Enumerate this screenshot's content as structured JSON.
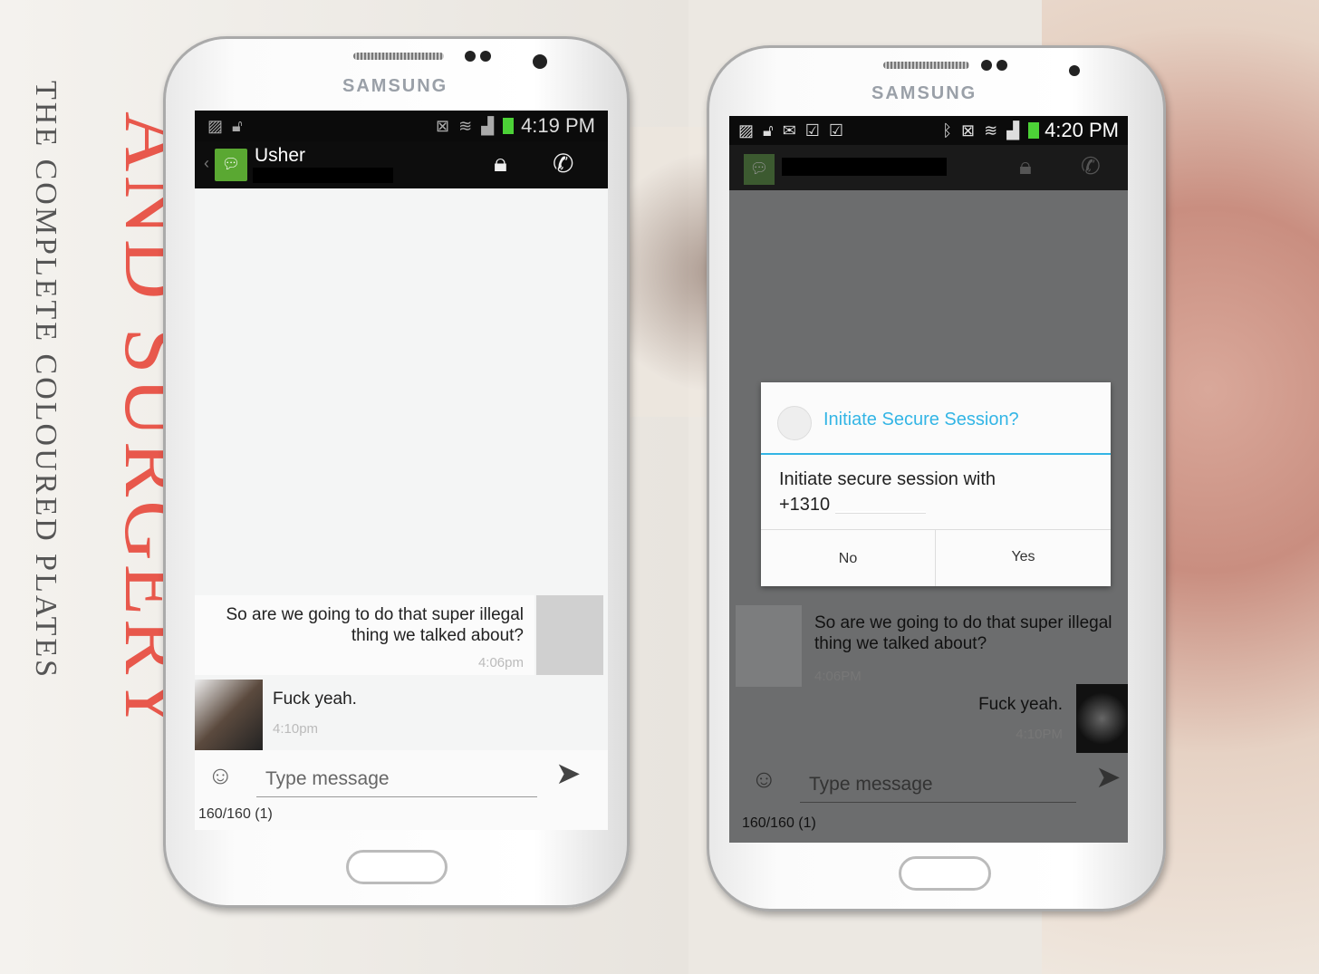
{
  "background": {
    "book_title": "AND SURGERY",
    "book_subtitle": "THE COMPLETE COLOURED PLATES"
  },
  "phone_left": {
    "brand": "SAMSUNG",
    "status": {
      "time": "4:19 PM",
      "icons": [
        "image-alert-icon",
        "unlock-icon",
        "vibrate-icon",
        "wifi-icon",
        "signal-icon",
        "battery-icon"
      ]
    },
    "action_bar": {
      "contact_name": "Usher",
      "icons": [
        "back-chevron-icon",
        "secure-sms-app-icon",
        "lock-icon",
        "phone-icon"
      ]
    },
    "messages": [
      {
        "direction": "incoming",
        "text": "So are we going to do that super illegal thing we talked about?",
        "time": "4:06pm"
      },
      {
        "direction": "outgoing",
        "text": "Fuck yeah.",
        "time": "4:10pm"
      }
    ],
    "composer": {
      "placeholder": "Type message",
      "counter": "160/160 (1)"
    }
  },
  "phone_right": {
    "brand": "SAMSUNG",
    "status": {
      "time": "4:20 PM",
      "icons": [
        "image-alert-icon",
        "unlock-icon",
        "email-icon",
        "task-check-icon",
        "task-check-icon",
        "bluetooth-icon",
        "mute-icon",
        "wifi-icon",
        "signal-icon",
        "battery-icon"
      ]
    },
    "dialog": {
      "title": "Initiate Secure Session?",
      "body": "Initiate secure session with",
      "number": "+1310",
      "no_label": "No",
      "yes_label": "Yes"
    },
    "messages": [
      {
        "direction": "incoming",
        "text": "So are we going to do that super illegal thing we talked about?",
        "time": "4:06PM"
      },
      {
        "direction": "outgoing",
        "text": "Fuck yeah.",
        "time": "4:10PM"
      }
    ],
    "composer": {
      "placeholder": "Type message",
      "counter": "160/160 (1)"
    }
  },
  "colors": {
    "accent": "#33b5e5",
    "battery": "#4cd137",
    "app_green": "#5aa832",
    "dim_overlay": "#6c6d6e"
  }
}
